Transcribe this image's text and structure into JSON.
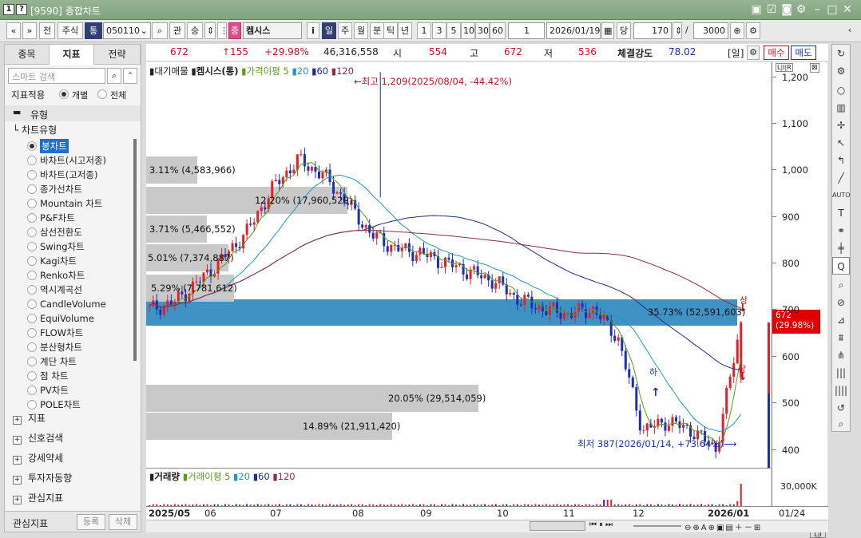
{
  "window": {
    "badges": [
      "1",
      "?"
    ],
    "title": "[9590] 종합차트",
    "buttons": [
      "restore-icon",
      "checkbox-icon",
      "camera-icon",
      "gear-icon",
      "minimize-icon",
      "maximize-icon",
      "close-icon"
    ]
  },
  "toolbar": {
    "nav_prev": "«",
    "nav_dn": "»",
    "jeon": "전",
    "stock": "주식",
    "tong": "통",
    "code": "050110",
    "search": "⌕",
    "gwan": "관",
    "seung": "승",
    "jeung": "증",
    "name": "켐시스",
    "info": "i",
    "periods": [
      "일",
      "주",
      "월",
      "분",
      "틱",
      "년"
    ],
    "nums": [
      "1",
      "3",
      "5",
      "10",
      "30",
      "60"
    ],
    "count1": "1",
    "date": "2026/01/19",
    "dang": "당",
    "count2": "170",
    "slash": "/",
    "count3": "3000"
  },
  "left_panel": {
    "tabs": [
      "종목",
      "지표",
      "전략"
    ],
    "search_placeholder": "스마트 검색",
    "apply_label": "지표적용",
    "apply_opts": [
      "개별",
      "전체"
    ],
    "folder": "유형",
    "subfolder": "차트유형",
    "items": [
      "봉차트",
      "바차트(시고저종)",
      "바차트(고저종)",
      "종가선차트",
      "Mountain 차트",
      "P&F차트",
      "삼선전환도",
      "Swing차트",
      "Kagi차트",
      "Renko차트",
      "역시계곡선",
      "CandleVolume",
      "EquiVolume",
      "FLOW차트",
      "분산형차트",
      "계단 차트",
      "점 차트",
      "PV차트",
      "POLE차트"
    ],
    "groups": [
      "지표",
      "신호검색",
      "강세약세",
      "투자자동향",
      "관심지표"
    ],
    "footer_label": "관심지표",
    "footer_btn1": "등록",
    "footer_btn2": "삭제"
  },
  "infobar": {
    "price": "672",
    "change": "↑155",
    "pct": "+29.98%",
    "volume": "46,316,558",
    "open_l": "시",
    "open": "554",
    "high_l": "고",
    "high": "672",
    "low_l": "저",
    "low": "536",
    "strength_l": "체결강도",
    "strength": "78.02",
    "period": "[일]",
    "buy": "매수",
    "sell": "매도"
  },
  "chart": {
    "legend": [
      "대기매물",
      "켐시스(통)",
      "가격이평 5",
      "20",
      "60",
      "120"
    ],
    "max_note": "←최고 1,209(2025/08/04, -44.42%)",
    "min_note": "최저 387(2026/01/14, +73.64%)⟶",
    "price_tag": "672",
    "price_tag2": "(29.98%)",
    "up_label": "상",
    "colors": {
      "up": "#e0202a",
      "down": "#1b2fb0",
      "ma5": "#5a9a1c",
      "ma20": "#1f97c8",
      "ma60": "#222b8c",
      "ma120": "#8a2c4a",
      "highlight": "#3f93c4",
      "bar": "#c6c6c6"
    },
    "yticks": [
      "1,200",
      "1,100",
      "1,000",
      "900",
      "800",
      "700",
      "600",
      "500",
      "400"
    ],
    "volume_profile": [
      {
        "label": "3.11% (4,583,966)"
      },
      {
        "label": "12.20% (17,960,529)"
      },
      {
        "label": "3.71% (5,466,552)"
      },
      {
        "label": "5.01% (7,374,887)"
      },
      {
        "label": "5.29% (7,781,612)"
      },
      {
        "label": "35.73% (52,591,603)"
      },
      {
        "label": "20.05% (29,514,059)"
      },
      {
        "label": "14.89% (21,911,420)"
      }
    ]
  },
  "volume": {
    "legend": [
      "거래량",
      "거래이평 5",
      "20",
      "60",
      "120"
    ],
    "ytick": "30,000K"
  },
  "xaxis": {
    "labels": [
      "2025/05",
      "06",
      "07",
      "08",
      "09",
      "10",
      "11",
      "12",
      "2026/01"
    ],
    "right": "01/24"
  },
  "chart_data": {
    "type": "candlestick",
    "title": "켐시스(통)",
    "x": [
      "2025/05",
      "06",
      "07",
      "08",
      "09",
      "10",
      "11",
      "12",
      "2026/01"
    ],
    "ylim": [
      360,
      1230
    ],
    "close_series": [
      {
        "name": "close",
        "values": [
          700,
          715,
          760,
          810,
          870,
          960,
          1020,
          990,
          930,
          860,
          830,
          820,
          800,
          780,
          760,
          720,
          700,
          690,
          700,
          640,
          440,
          460,
          440,
          400,
          672
        ]
      }
    ],
    "max": {
      "value": 1209,
      "date": "2025/08/04"
    },
    "min": {
      "value": 387,
      "date": "2026/01/14"
    },
    "last": 672
  }
}
